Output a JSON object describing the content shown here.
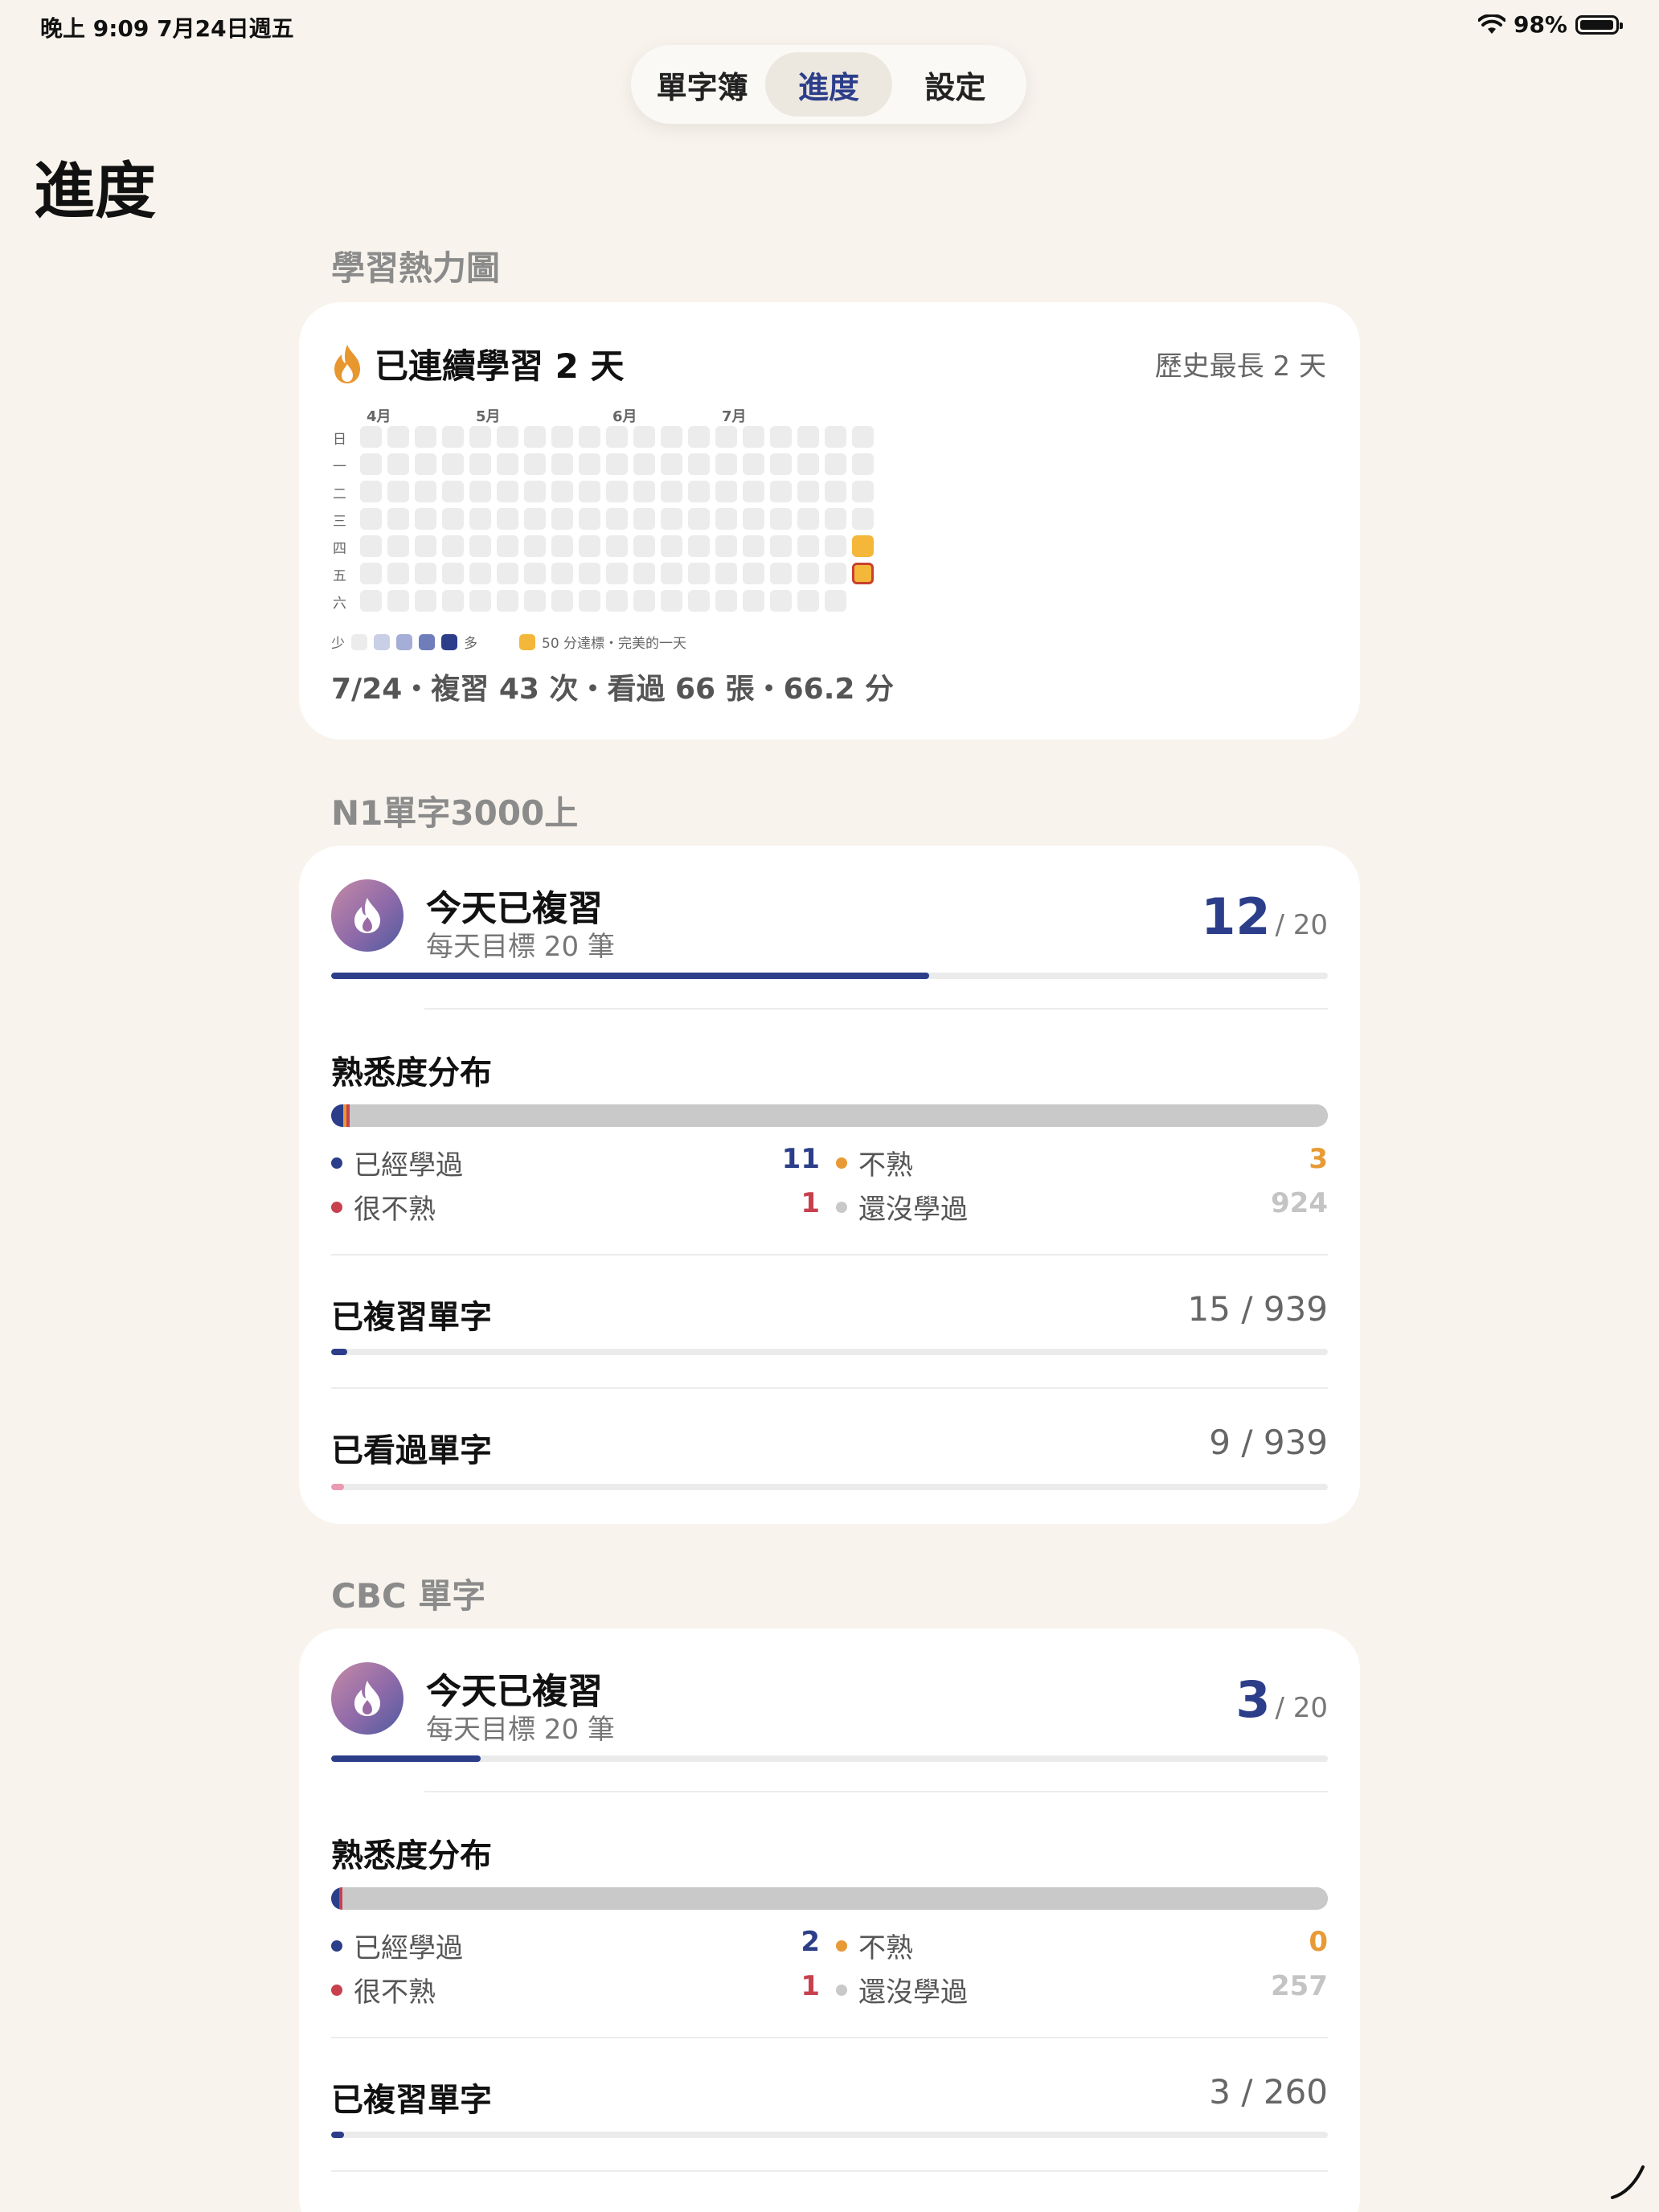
{
  "status": {
    "time": "晚上 9:09   7月24日週五",
    "battery": "98%",
    "battery_level": 0.98
  },
  "nav": {
    "tabs": [
      {
        "label": "單字簿"
      },
      {
        "label": "進度"
      },
      {
        "label": "設定"
      }
    ],
    "active": 1
  },
  "page": {
    "title": "進度"
  },
  "heatmap": {
    "section_title": "學習熱力圖",
    "streak_label": "已連續學習 2 天",
    "best_label": "歷史最長 2 天",
    "months": [
      "4月",
      "5月",
      "6月",
      "7月"
    ],
    "weekdays": [
      "日",
      "一",
      "二",
      "三",
      "四",
      "五",
      "六"
    ],
    "legend": {
      "less": "少",
      "more": "多",
      "goal_text": "50 分達標・完美的一天"
    },
    "legend_colors": [
      "#ececec",
      "#c9cfe6",
      "#a5aed6",
      "#6f7eba",
      "#2c3e8a"
    ],
    "goal_color": "#f4b73a",
    "today_stats": "7/24・複習 43 次・看過 66 張・66.2 分"
  },
  "decks": [
    {
      "section_title": "N1單字3000上",
      "today_label": "今天已複習",
      "goal_label": "每天目標 20 筆",
      "reviewed": "12",
      "goal": "/ 20",
      "progress": 0.6,
      "familiarity_title": "熟悉度分布",
      "dist": {
        "learned": {
          "label": "已經學過",
          "value": "11",
          "color": "#2c3e8a"
        },
        "unfamiliar": {
          "label": "不熟",
          "value": "3",
          "color": "#e89a35"
        },
        "very_unfamiliar": {
          "label": "很不熟",
          "value": "1",
          "color": "#c8404d"
        },
        "not_learned": {
          "label": "還沒學過",
          "value": "924",
          "color": "#c9c9c9"
        }
      },
      "reviewed_words": {
        "label": "已複習單字",
        "value": "15 / 939",
        "fraction": 0.016
      },
      "seen_words": {
        "label": "已看過單字",
        "value": "9 / 939",
        "fraction": 0.0096
      }
    },
    {
      "section_title": "CBC 單字",
      "today_label": "今天已複習",
      "goal_label": "每天目標 20 筆",
      "reviewed": "3",
      "goal": "/ 20",
      "progress": 0.15,
      "familiarity_title": "熟悉度分布",
      "dist": {
        "learned": {
          "label": "已經學過",
          "value": "2",
          "color": "#2c3e8a"
        },
        "unfamiliar": {
          "label": "不熟",
          "value": "0",
          "color": "#e89a35"
        },
        "very_unfamiliar": {
          "label": "很不熟",
          "value": "1",
          "color": "#c8404d"
        },
        "not_learned": {
          "label": "還沒學過",
          "value": "257",
          "color": "#c9c9c9"
        }
      },
      "reviewed_words": {
        "label": "已複習單字",
        "value": "3 / 260",
        "fraction": 0.0115
      }
    }
  ]
}
